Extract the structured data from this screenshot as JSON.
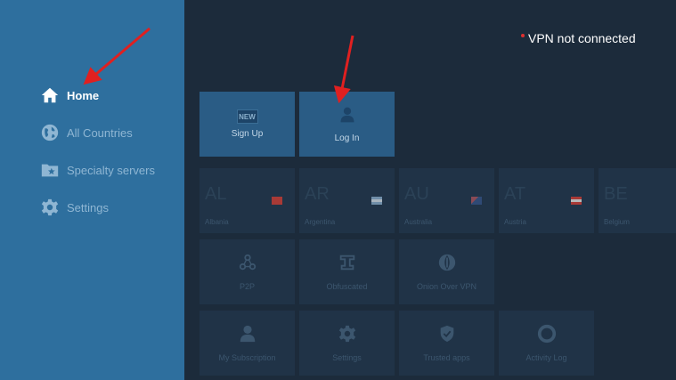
{
  "status": {
    "text": "VPN not connected",
    "dot_color": "#e03030"
  },
  "sidebar": {
    "items": [
      {
        "label": "Home",
        "icon": "home-icon",
        "active": true
      },
      {
        "label": "All Countries",
        "icon": "globe-icon"
      },
      {
        "label": "Specialty servers",
        "icon": "folder-star-icon"
      },
      {
        "label": "Settings",
        "icon": "gear-icon"
      }
    ]
  },
  "top_tiles": {
    "signup": {
      "label": "Sign Up",
      "badge": "NEW"
    },
    "login": {
      "label": "Log In",
      "icon": "user-icon"
    }
  },
  "countries": [
    {
      "code": "AL",
      "name": "Albania"
    },
    {
      "code": "AR",
      "name": "Argentina"
    },
    {
      "code": "AU",
      "name": "Australia"
    },
    {
      "code": "AT",
      "name": "Austria"
    },
    {
      "code": "BE",
      "name": "Belgium"
    }
  ],
  "specialty": [
    {
      "label": "P2P",
      "icon": "p2p-icon"
    },
    {
      "label": "Obfuscated",
      "icon": "obfuscated-icon"
    },
    {
      "label": "Onion Over VPN",
      "icon": "onion-icon"
    }
  ],
  "bottom_tiles": [
    {
      "label": "My Subscription",
      "icon": "user-icon"
    },
    {
      "label": "Settings",
      "icon": "gear-icon"
    },
    {
      "label": "Trusted apps",
      "icon": "shield-check-icon"
    },
    {
      "label": "Activity Log",
      "icon": "lifebuoy-icon"
    }
  ],
  "annotation_color": "#e02020"
}
